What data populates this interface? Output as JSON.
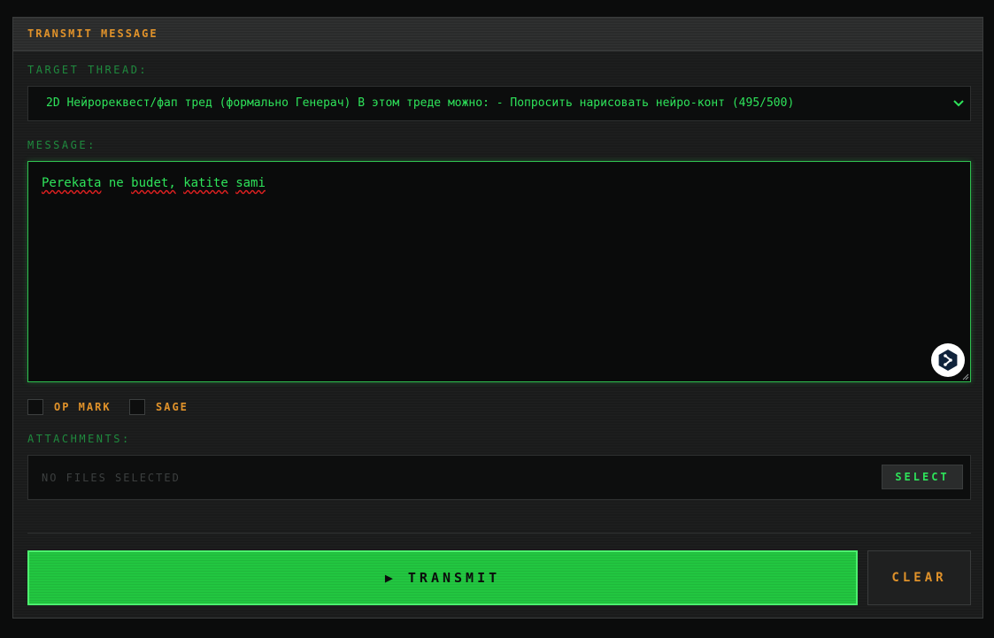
{
  "panel": {
    "title": "TRANSMIT MESSAGE"
  },
  "thread": {
    "label": "TARGET THREAD:",
    "selected": "2D Нейрореквест/фап тред (формально Генерач) В этом треде можно: - Попросить нарисовать нейро-конт (495/500)"
  },
  "message": {
    "label": "MESSAGE:",
    "words": [
      "Perekata",
      "ne",
      "budet,",
      "katite",
      "sami"
    ]
  },
  "options": {
    "op_mark": "OP MARK",
    "sage": "SAGE",
    "op_mark_checked": false,
    "sage_checked": false
  },
  "attachments": {
    "label": "ATTACHMENTS:",
    "status": "NO FILES SELECTED",
    "select_label": "SELECT"
  },
  "actions": {
    "transmit_icon": "▶",
    "transmit_label": "TRANSMIT",
    "clear_label": "CLEAR"
  },
  "colors": {
    "accent_green": "#2ee35a",
    "accent_orange": "#e0922a",
    "button_green": "#22c640"
  }
}
